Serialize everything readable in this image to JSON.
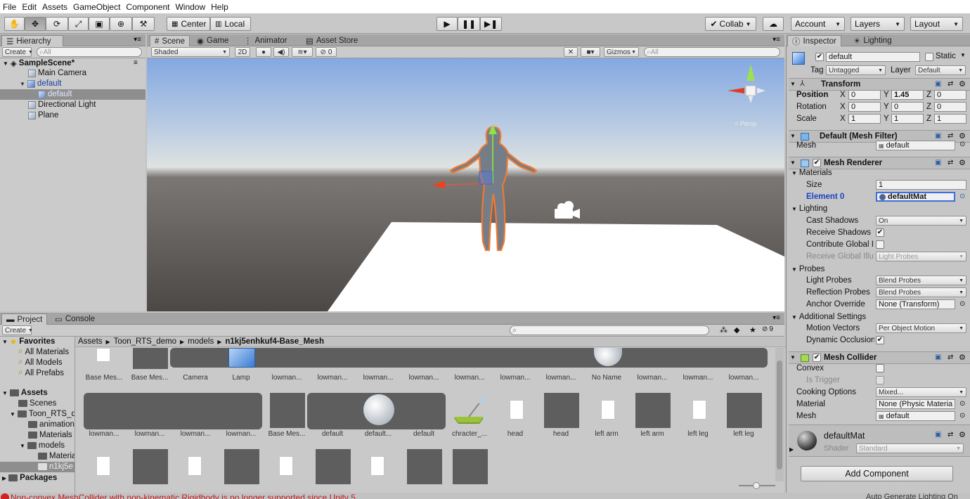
{
  "menu": [
    "File",
    "Edit",
    "Assets",
    "GameObject",
    "Component",
    "Window",
    "Help"
  ],
  "toolbar": {
    "pivot": "Center",
    "space": "Local",
    "collab": "Collab",
    "account": "Account",
    "layers": "Layers",
    "layout": "Layout"
  },
  "hierarchy": {
    "tab": "Hierarchy",
    "create": "Create",
    "search_placeholder": "All",
    "scene": "SampleScene*",
    "items": [
      "Main Camera",
      "default",
      "default",
      "Directional Light",
      "Plane"
    ]
  },
  "scene_view": {
    "tabs": [
      "Scene",
      "Game",
      "Animator",
      "Asset Store"
    ],
    "shading": "Shaded",
    "mode_2d": "2D",
    "hidden_count": "0",
    "gizmos": "Gizmos",
    "search_placeholder": "All",
    "persp": "< Persp"
  },
  "project": {
    "tabs": [
      "Project",
      "Console"
    ],
    "create": "Create",
    "filter_count": "9",
    "breadcrumb": [
      "Assets",
      "Toon_RTS_demo",
      "models",
      "n1kj5enhkuf4-Base_Mesh"
    ],
    "favorites": {
      "title": "Favorites",
      "items": [
        "All Materials",
        "All Models",
        "All Prefabs"
      ]
    },
    "assets": {
      "title": "Assets",
      "items": [
        "Scenes",
        "Toon_RTS_d",
        "animation",
        "Materials",
        "models",
        "Materia",
        "n1kj5e"
      ]
    },
    "packages": "Packages",
    "row1": [
      "Base Mes...",
      "Base Mes...",
      "Camera",
      "Lamp",
      "lowman...",
      "lowman...",
      "lowman...",
      "lowman...",
      "lowman...",
      "lowman...",
      "lowman...",
      "No Name",
      "lowman...",
      "lowman...",
      "lowman..."
    ],
    "row2": [
      "lowman...",
      "lowman...",
      "lowman...",
      "lowman...",
      "Base Mes...",
      "default",
      "default...",
      "default",
      "chracter_...",
      "head",
      "head",
      "left arm",
      "left arm",
      "left leg",
      "left leg"
    ]
  },
  "inspector": {
    "tabs": [
      "Inspector",
      "Lighting"
    ],
    "object_name": "default",
    "static_label": "Static",
    "tag_label": "Tag",
    "tag_value": "Untagged",
    "layer_label": "Layer",
    "layer_value": "Default",
    "transform": {
      "title": "Transform",
      "position": {
        "label": "Position",
        "x": "0",
        "y": "1.45",
        "z": "0"
      },
      "rotation": {
        "label": "Rotation",
        "x": "0",
        "y": "0",
        "z": "0"
      },
      "scale": {
        "label": "Scale",
        "x": "1",
        "y": "1",
        "z": "1"
      }
    },
    "mesh_filter": {
      "title": "Default (Mesh Filter)",
      "mesh_label": "Mesh",
      "mesh_value": "default"
    },
    "mesh_renderer": {
      "title": "Mesh Renderer",
      "materials": "Materials",
      "size_label": "Size",
      "size_value": "1",
      "element0_label": "Element 0",
      "element0_value": "defaultMat",
      "lighting": "Lighting",
      "cast_shadows_label": "Cast Shadows",
      "cast_shadows_value": "On",
      "receive_shadows_label": "Receive Shadows",
      "contribute_gi_label": "Contribute Global I",
      "receive_gi_label": "Receive Global Illu",
      "receive_gi_value": "Light Probes",
      "probes": "Probes",
      "light_probes_label": "Light Probes",
      "light_probes_value": "Blend Probes",
      "reflection_probes_label": "Reflection Probes",
      "reflection_probes_value": "Blend Probes",
      "anchor_label": "Anchor Override",
      "anchor_value": "None (Transform)",
      "additional": "Additional Settings",
      "motion_label": "Motion Vectors",
      "motion_value": "Per Object Motion",
      "dynamic_label": "Dynamic Occlusion"
    },
    "mesh_collider": {
      "title": "Mesh Collider",
      "convex_label": "Convex",
      "trigger_label": "Is Trigger",
      "cooking_label": "Cooking Options",
      "cooking_value": "Mixed...",
      "material_label": "Material",
      "material_value": "None (Physic Materia",
      "mesh_label": "Mesh",
      "mesh_value": "default"
    },
    "material": {
      "name": "defaultMat",
      "shader_label": "Shader",
      "shader_value": "Standard"
    },
    "add_component": "Add Component"
  },
  "status": {
    "error": "Non-convex MeshCollider with non-kinematic Rigidbody is no longer supported since Unity 5.",
    "right": "Auto Generate Lighting On"
  }
}
